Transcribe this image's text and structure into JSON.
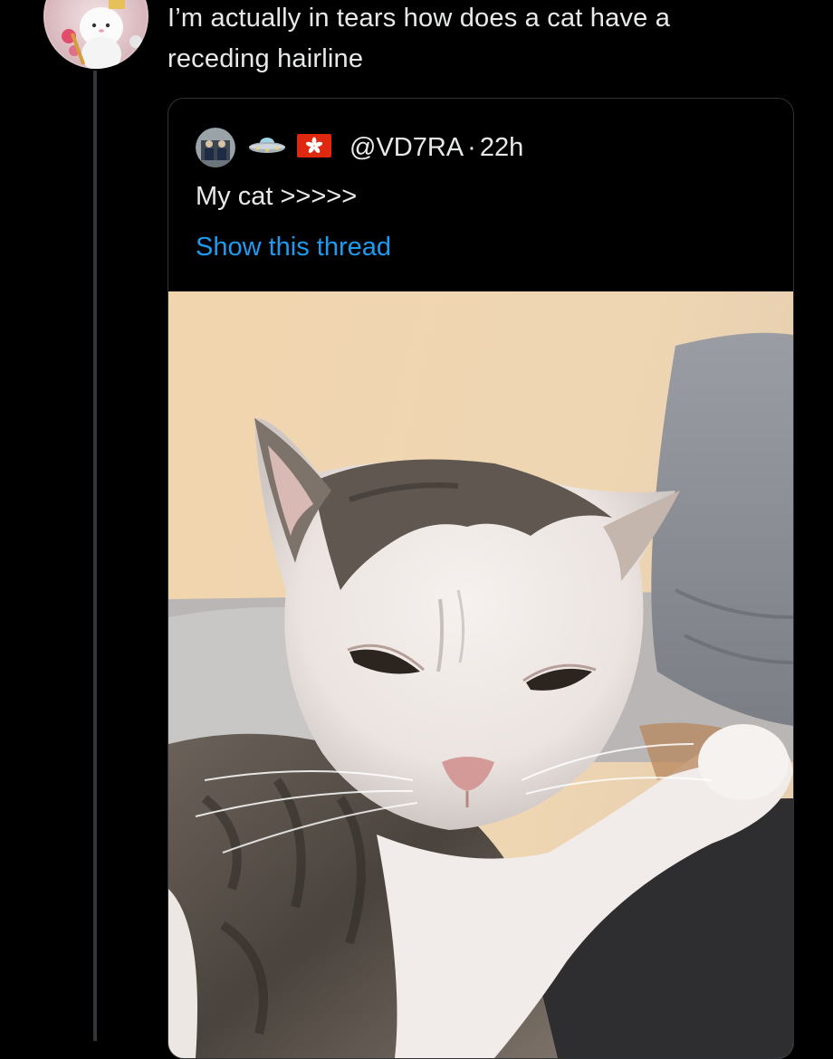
{
  "tweet": {
    "text_line1": "I’m actually in tears how does a cat have a",
    "text_line2": "receding hairline",
    "avatar_icon": "bunny-avatar-icon"
  },
  "quote": {
    "avatar_icon": "user-avatar-icon",
    "emoji_icons": [
      "ufo-icon",
      "hong-kong-flag-icon"
    ],
    "handle": "@VD7RA",
    "separator": "·",
    "time": "22h",
    "text": "My cat >>>>>",
    "show_thread": "Show this thread",
    "image_icon": "cat-photo"
  },
  "colors": {
    "background": "#000000",
    "text": "#e7e9ea",
    "link": "#1d9bf0",
    "border": "#2f3336"
  }
}
